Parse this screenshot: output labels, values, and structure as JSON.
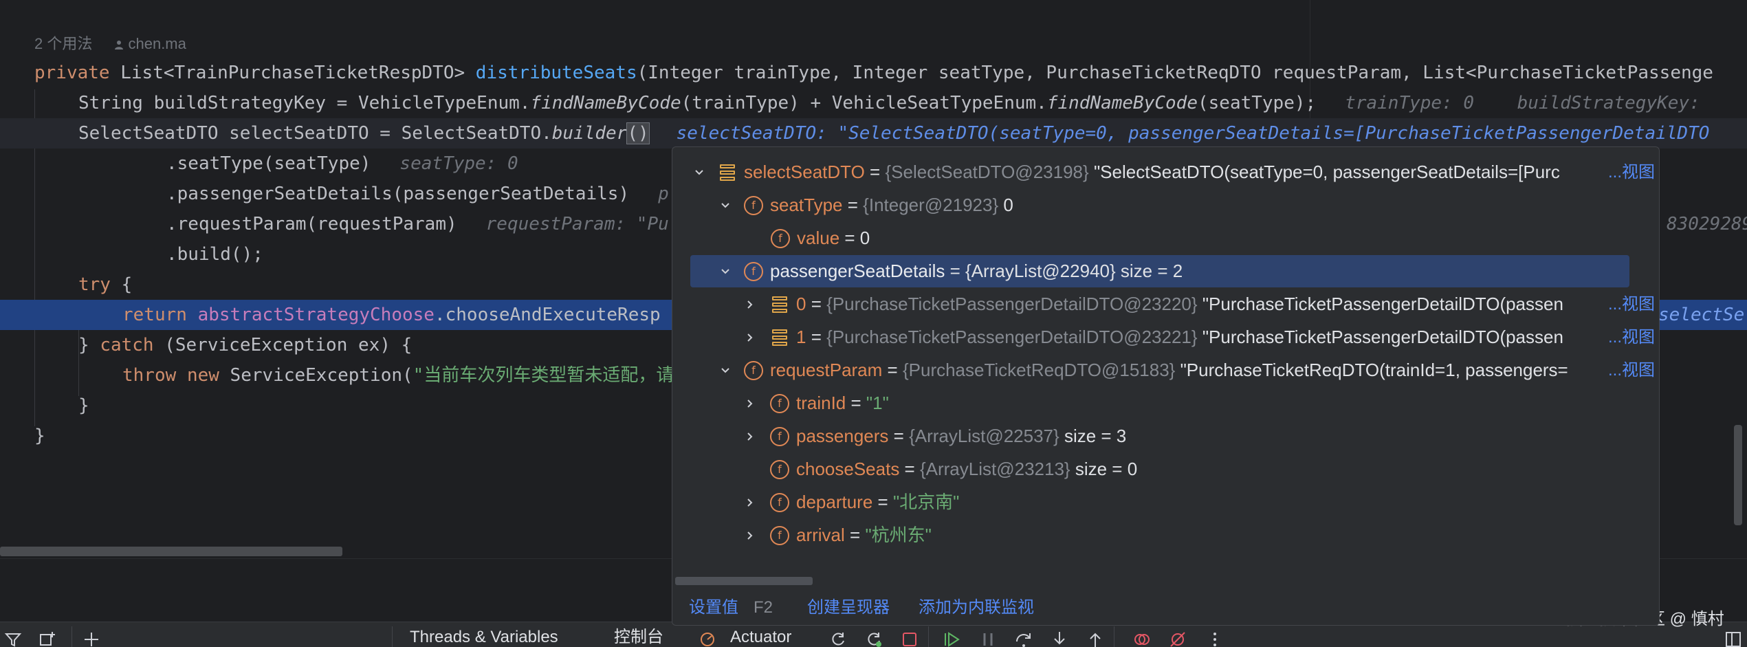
{
  "editor": {
    "usage_count": "2 个用法",
    "author": "chen.ma",
    "lines": {
      "l1_kw": "private",
      "l1_a": " List<TrainPurchaseTicketRespDTO> ",
      "l1_fn": "distributeSeats",
      "l1_b": "(Integer trainType, Integer seatType, PurchaseTicketReqDTO requestParam, List<PurchaseTicketPassenge",
      "l2_a": "String buildStrategyKey = VehicleTypeEnum.",
      "l2_it1": "findNameByCode",
      "l2_b": "(trainType) + VehicleSeatTypeEnum.",
      "l2_it2": "findNameByCode",
      "l2_c": "(seatType);",
      "l2_hint": "trainType: 0    buildStrategyKey:",
      "l3_a": "SelectSeatDTO selectSeatDTO = SelectSeatDTO.",
      "l3_it": "builder",
      "l3_paren": "()",
      "l3_hint": "selectSeatDTO: \"SelectSeatDTO(seatType=0, passengerSeatDetails=[PurchaseTicketPassengerDetailDTO",
      "l4_a": ".seatType(seatType)",
      "l4_hint": "seatType: 0",
      "l5_a": ".passengerSeatDetails(passengerSeatDetails)",
      "l5_hint": "p",
      "l6_a": ".requestParam(requestParam)",
      "l6_hint": "requestParam: \"Pu",
      "l6_right": "83029289",
      "l7_a": ".build();",
      "l8_kw": "try",
      "l8_a": " {",
      "l9_kw": "return",
      "l9_field": "abstractStrategyChoose",
      "l9_a": ".chooseAndExecuteResp",
      "l9_right": "selectSe",
      "l10_a": "} ",
      "l10_kw": "catch",
      "l10_b": " (ServiceException ex) {",
      "l11_kw1": "throw",
      "l11_kw2": "new",
      "l11_a": " ServiceException(",
      "l11_st": "\"当前车次列车类型暂未适配，请",
      "l12_a": "}",
      "l13_a": "}"
    }
  },
  "popup": {
    "rows": [
      {
        "name": "selectSeatDTO",
        "type": "{SelectSeatDTO@23198}",
        "value": "\"SelectSeatDTO(seatType=0, passengerSeatDetails=[Purc",
        "link": "...视图"
      },
      {
        "name": "seatType",
        "type": "{Integer@21923}",
        "value": "0"
      },
      {
        "name": "value",
        "value": "0"
      },
      {
        "name": "passengerSeatDetails",
        "type": "{ArrayList@22940}",
        "value": "size = 2"
      },
      {
        "name": "0",
        "type": "{PurchaseTicketPassengerDetailDTO@23220}",
        "value": "\"PurchaseTicketPassengerDetailDTO(passen",
        "link": "...视图"
      },
      {
        "name": "1",
        "type": "{PurchaseTicketPassengerDetailDTO@23221}",
        "value": "\"PurchaseTicketPassengerDetailDTO(passen",
        "link": "...视图"
      },
      {
        "name": "requestParam",
        "type": "{PurchaseTicketReqDTO@15183}",
        "value": "\"PurchaseTicketReqDTO(trainId=1, passengers=",
        "link": "...视图"
      },
      {
        "name": "trainId",
        "value": "\"1\""
      },
      {
        "name": "passengers",
        "type": "{ArrayList@22537}",
        "value": "size = 3"
      },
      {
        "name": "chooseSeats",
        "type": "{ArrayList@23213}",
        "value": "size = 0"
      },
      {
        "name": "departure",
        "value": "\"北京南\""
      },
      {
        "name": "arrival",
        "value": "\"杭州东\""
      }
    ],
    "footer": {
      "set_value": "设置值",
      "set_value_key": "F2",
      "create_renderer": "创建呈现器",
      "add_inline_watch": "添加为内联监视"
    }
  },
  "toolbar": {
    "threads_variables": "Threads & Variables",
    "console": "控制台",
    "actuator": "Actuator"
  },
  "watermark": "掘金技术社区 @ 慎村",
  "colors": {
    "editor_bg": "#1e1f22",
    "panel_bg": "#2b2d30",
    "exec_line": "#214283",
    "selection": "#2e436e",
    "keyword": "#cf8e6d",
    "function": "#56a8f5",
    "string": "#6aab73",
    "field_purple": "#c77dbb",
    "link": "#548af7",
    "field_icon": "#e08855"
  }
}
